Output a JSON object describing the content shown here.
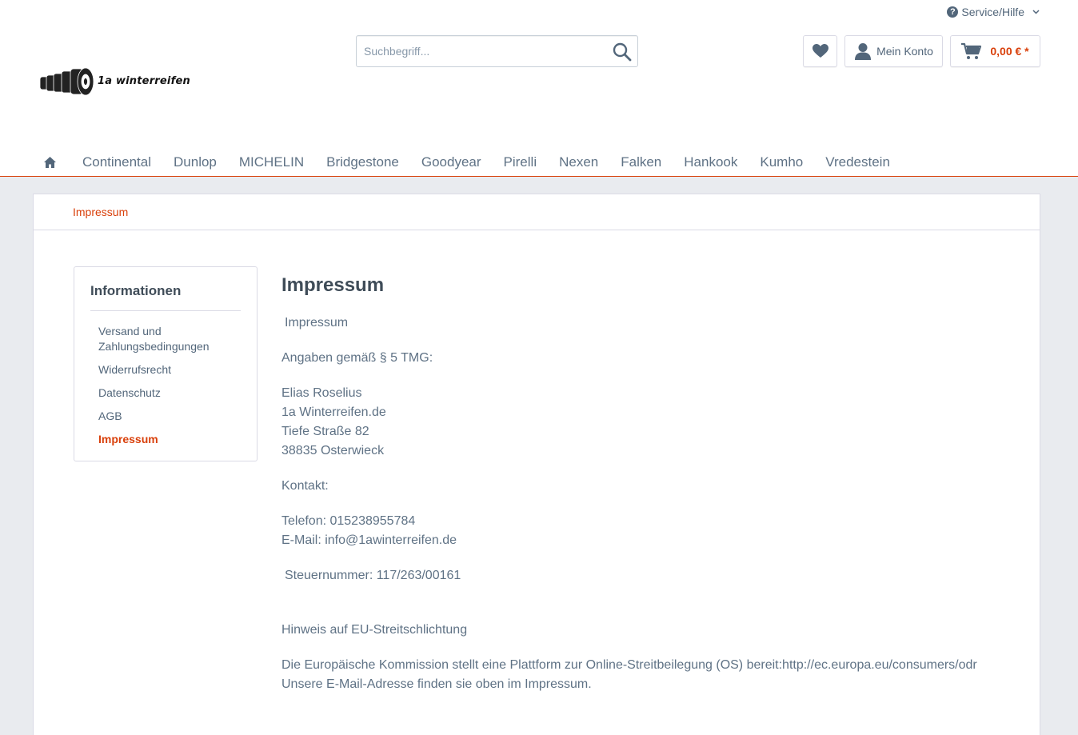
{
  "header": {
    "service_label": "Service/Hilfe",
    "logo_text": "1a winterreifen",
    "search_placeholder": "Suchbegriff...",
    "account_label": "Mein Konto",
    "cart_amount": "0,00 € *"
  },
  "nav": {
    "items": [
      "Continental",
      "Dunlop",
      "MICHELIN",
      "Bridgestone",
      "Goodyear",
      "Pirelli",
      "Nexen",
      "Falken",
      "Hankook",
      "Kumho",
      "Vredestein"
    ]
  },
  "breadcrumb": {
    "current": "Impressum"
  },
  "sidebar": {
    "title": "Informationen",
    "items": [
      "Versand und Zahlungsbedingungen",
      "Widerrufsrecht",
      "Datenschutz",
      "AGB",
      "Impressum"
    ]
  },
  "main": {
    "title": "Impressum",
    "subtitle": "Impressum",
    "tmg": "Angaben gemäß § 5 TMG:",
    "address": [
      "Elias Roselius",
      "1a Winterreifen.de",
      "Tiefe Straße 82",
      "38835 Osterwieck"
    ],
    "kontakt_label": "Kontakt:",
    "phone": "Telefon: 015238955784",
    "email": "E-Mail: info@1awinterreifen.de",
    "tax": "Steuernummer: 117/263/00161",
    "eu_heading": "Hinweis auf EU-Streitschlichtung",
    "eu_text1": "Die Europäische Kommission stellt eine Plattform zur Online-Streitbeilegung (OS) bereit:http://ec.europa.eu/consumers/odr",
    "eu_text2": "Unsere E-Mail-Adresse finden sie oben im Impressum."
  },
  "colors": {
    "accent": "#d9400b",
    "text": "#52667a",
    "heading": "#3f4c58",
    "background": "#e9ebef"
  },
  "icons": [
    "question-icon",
    "chevron-down-icon",
    "search-icon",
    "heart-icon",
    "user-icon",
    "cart-icon",
    "home-icon"
  ]
}
